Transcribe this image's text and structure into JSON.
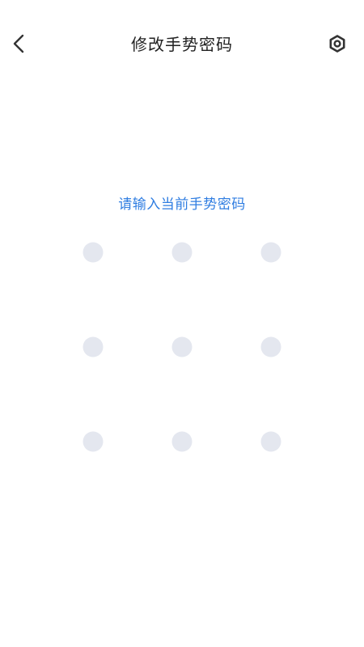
{
  "header": {
    "title": "修改手势密码",
    "back_icon": "chevron-left-icon",
    "settings_icon": "gear-icon"
  },
  "prompt": {
    "text": "请输入当前手势密码"
  },
  "pattern": {
    "rows": 3,
    "cols": 3,
    "dot_color": "#E4E7EF"
  },
  "colors": {
    "accent": "#2F7DE1",
    "title": "#222222",
    "icon": "#333333",
    "background": "#FFFFFF"
  }
}
